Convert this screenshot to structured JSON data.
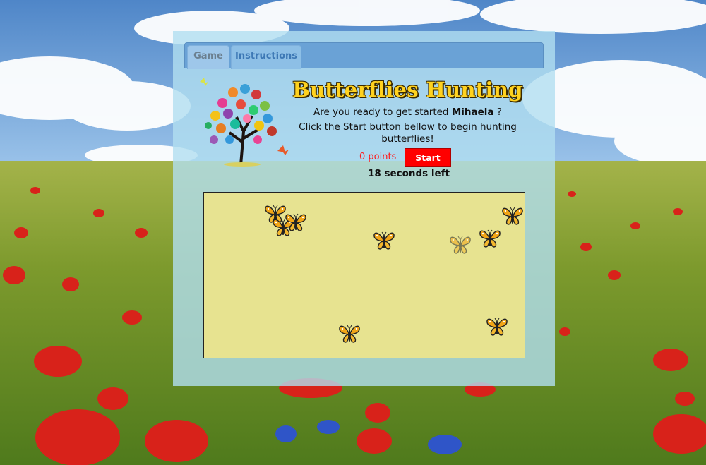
{
  "tabs": [
    {
      "label": "Game",
      "active": true
    },
    {
      "label": "Instructions",
      "active": false
    }
  ],
  "game": {
    "title": "Butterflies Hunting",
    "greeting_prefix": "Are you ready to get started",
    "player_name": "Mihaela",
    "greeting_suffix": "?",
    "instruction": "Click the Start button bellow to begin hunting butterflies!",
    "points_text": "0 points",
    "start_label": "Start",
    "timer_text": "18 seconds left"
  },
  "colors": {
    "title": "#ffd21f",
    "start_button": "#ff0000",
    "points": "#ff1a1a",
    "playfield": "#ece48c"
  },
  "icons": {
    "butterfly": "butterfly-icon",
    "tree": "butterfly-tree-logo"
  },
  "butterflies_visible": 9
}
